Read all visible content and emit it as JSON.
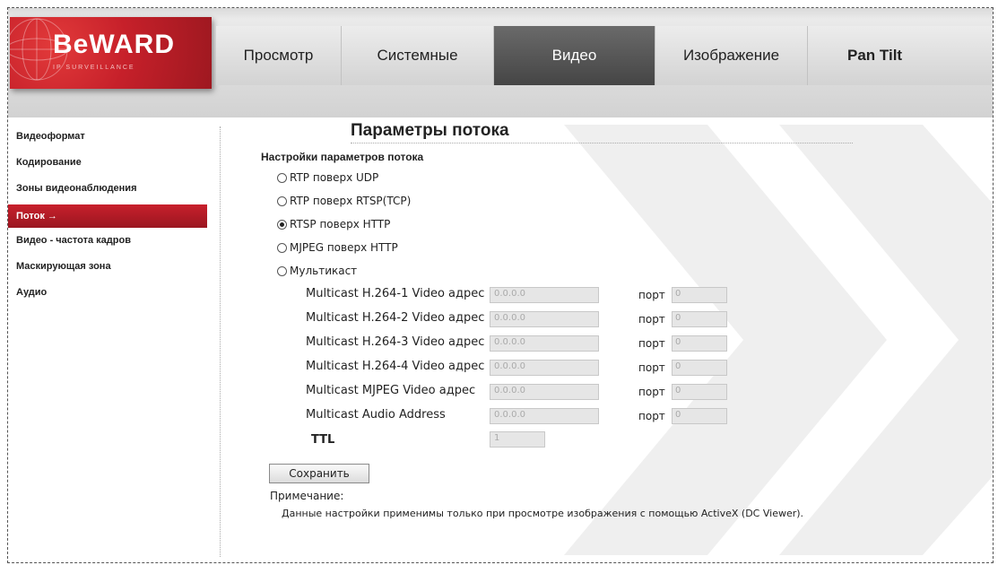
{
  "brand": {
    "name": "BeWARD",
    "tagline": "IP SURVEILLANCE"
  },
  "tabs": [
    {
      "label": "Просмотр"
    },
    {
      "label": "Системные"
    },
    {
      "label": "Видео",
      "active": true
    },
    {
      "label": "Изображение"
    },
    {
      "label": "Pan Tilt"
    }
  ],
  "sidebar": {
    "items": [
      {
        "label": "Видеоформат"
      },
      {
        "label": "Кодирование"
      },
      {
        "label": "Зоны видеонаблюдения"
      },
      {
        "label": "Поток →",
        "active": true
      },
      {
        "label": "Видео - частота кадров"
      },
      {
        "label": "Маскирующая зона"
      },
      {
        "label": "Аудио"
      }
    ]
  },
  "main": {
    "title": "Параметры потока",
    "section_title": "Настройки параметров потока",
    "stream_options": [
      {
        "label": "RTP поверх UDP",
        "checked": false
      },
      {
        "label": "RTP поверх RTSP(TCP)",
        "checked": false
      },
      {
        "label": "RTSP поверх HTTP",
        "checked": true
      },
      {
        "label": "MJPEG поверх HTTP",
        "checked": false
      },
      {
        "label": "Мультикаст",
        "checked": false
      }
    ],
    "multicast_fields": [
      {
        "label": "Multicast H.264-1 Video адрес",
        "value": "0.0.0.0",
        "port_label": "порт",
        "port": "0"
      },
      {
        "label": "Multicast H.264-2 Video адрес",
        "value": "0.0.0.0",
        "port_label": "порт",
        "port": "0"
      },
      {
        "label": "Multicast H.264-3 Video адрес",
        "value": "0.0.0.0",
        "port_label": "порт",
        "port": "0"
      },
      {
        "label": "Multicast H.264-4 Video адрес",
        "value": "0.0.0.0",
        "port_label": "порт",
        "port": "0"
      },
      {
        "label": "Multicast MJPEG Video адрес",
        "value": "0.0.0.0",
        "port_label": "порт",
        "port": "0"
      },
      {
        "label": "Multicast Audio Address",
        "value": "0.0.0.0",
        "port_label": "порт",
        "port": "0"
      }
    ],
    "ttl": {
      "label": "TTL",
      "value": "1"
    },
    "save_label": "Сохранить",
    "note_title": "Примечание:",
    "note_text": "Данные настройки применимы только при просмотре изображения с помощью ActiveX (DC Viewer)."
  },
  "colors": {
    "accent": "#c01c28",
    "active_tab": "#555555",
    "header_bg": "#d9d9d9"
  }
}
